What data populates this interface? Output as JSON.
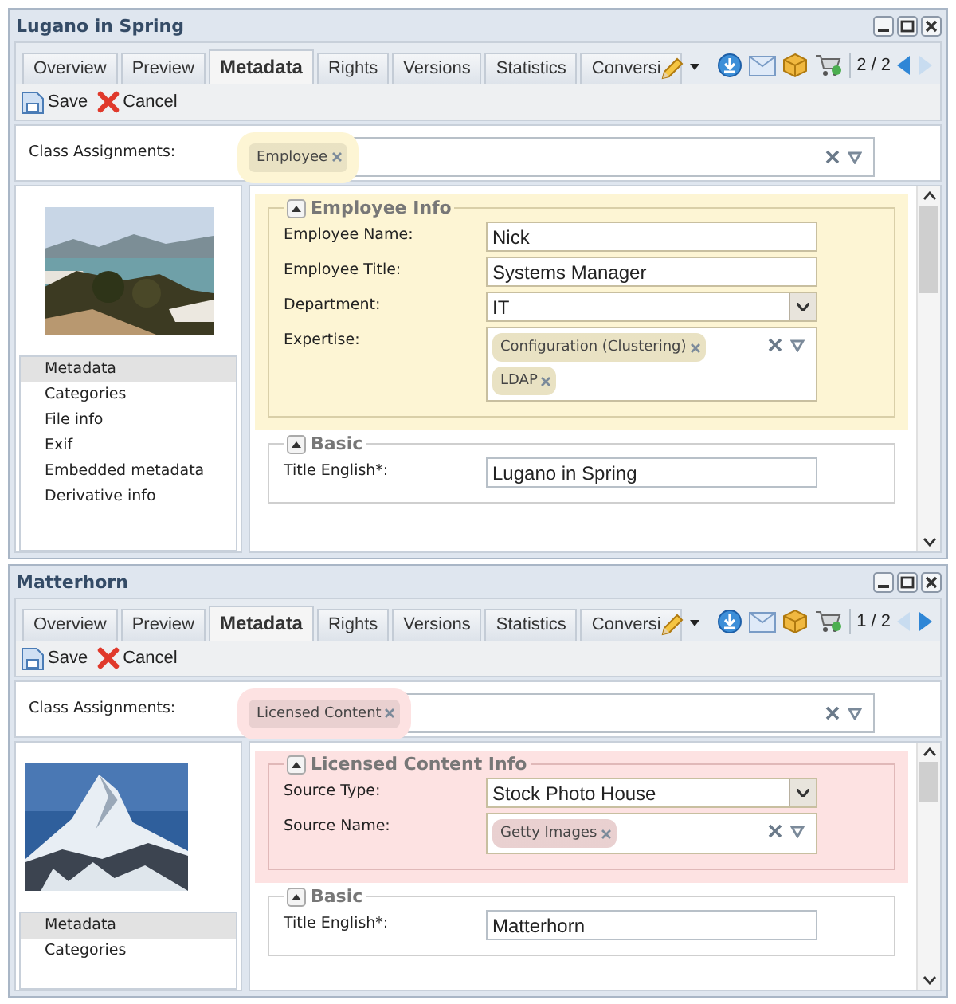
{
  "panels": [
    {
      "title": "Lugano in Spring",
      "color": "#fdf5d4",
      "tabs": [
        {
          "label": "Overview",
          "selected": false
        },
        {
          "label": "Preview",
          "selected": false
        },
        {
          "label": "Metadata",
          "selected": true
        },
        {
          "label": "Rights",
          "selected": false
        },
        {
          "label": "Versions",
          "selected": false
        },
        {
          "label": "Statistics",
          "selected": false
        },
        {
          "label": "Conversi",
          "selected": false
        }
      ],
      "pager": {
        "text": "2 / 2",
        "prev_disabled": false,
        "next_disabled": true
      },
      "toolbar": [
        {
          "kind": "save",
          "label": "Save"
        },
        {
          "kind": "cancel",
          "label": "Cancel"
        }
      ],
      "class_assignments": {
        "label": "Class Assignments:",
        "tags": [
          "Employee"
        ]
      },
      "nav": [
        {
          "label": "Metadata",
          "selected": true
        },
        {
          "label": "Categories",
          "selected": false
        },
        {
          "label": "File info",
          "selected": false
        },
        {
          "label": "Exif",
          "selected": false
        },
        {
          "label": "Embedded metadata",
          "selected": false
        },
        {
          "label": "Derivative info",
          "selected": false
        }
      ],
      "sections": [
        {
          "title": "Employee Info",
          "highlighted": true,
          "fields": [
            {
              "kind": "text",
              "label": "Employee Name:",
              "value": "Nick"
            },
            {
              "kind": "text",
              "label": "Employee Title:",
              "value": "Systems Manager"
            },
            {
              "kind": "select",
              "label": "Department:",
              "value": "IT"
            },
            {
              "kind": "tags",
              "label": "Expertise:",
              "tags": [
                "Configuration (Clustering)",
                "LDAP"
              ]
            }
          ]
        },
        {
          "title": "Basic",
          "highlighted": false,
          "fields": [
            {
              "kind": "text",
              "label": "Title English*:",
              "value": "Lugano in Spring"
            }
          ]
        }
      ]
    },
    {
      "title": "Matterhorn",
      "color": "#fde2e2",
      "tabs": [
        {
          "label": "Overview",
          "selected": false
        },
        {
          "label": "Preview",
          "selected": false
        },
        {
          "label": "Metadata",
          "selected": true
        },
        {
          "label": "Rights",
          "selected": false
        },
        {
          "label": "Versions",
          "selected": false
        },
        {
          "label": "Statistics",
          "selected": false
        },
        {
          "label": "Conversi",
          "selected": false
        }
      ],
      "pager": {
        "text": "1 / 2",
        "prev_disabled": true,
        "next_disabled": false
      },
      "toolbar": [
        {
          "kind": "save",
          "label": "Save"
        },
        {
          "kind": "cancel",
          "label": "Cancel"
        }
      ],
      "class_assignments": {
        "label": "Class Assignments:",
        "tags": [
          "Licensed Content"
        ]
      },
      "nav": [
        {
          "label": "Metadata",
          "selected": true
        },
        {
          "label": "Categories",
          "selected": false
        }
      ],
      "sections": [
        {
          "title": "Licensed Content Info",
          "highlighted": true,
          "fields": [
            {
              "kind": "select",
              "label": "Source Type:",
              "value": "Stock Photo House"
            },
            {
              "kind": "tags",
              "label": "Source Name:",
              "tags": [
                "Getty Images"
              ]
            }
          ]
        },
        {
          "title": "Basic",
          "highlighted": false,
          "fields": [
            {
              "kind": "text",
              "label": "Title English*:",
              "value": "Matterhorn"
            }
          ]
        }
      ]
    }
  ]
}
